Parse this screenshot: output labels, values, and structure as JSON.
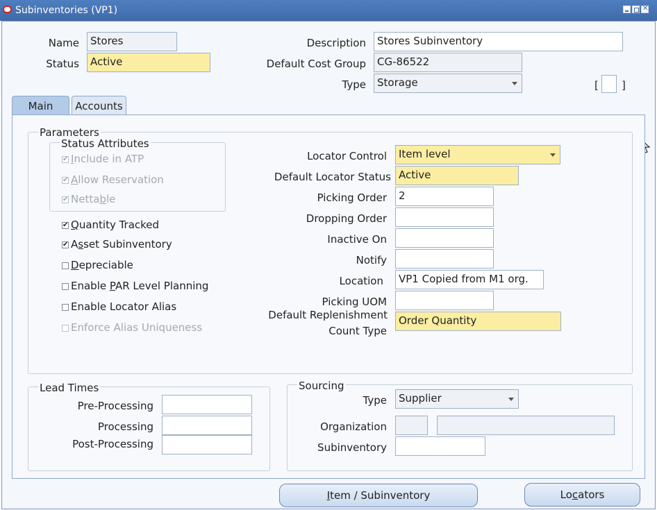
{
  "window": {
    "title": "Subinventories (VP1)"
  },
  "header": {
    "name_label": "Name",
    "name_value": "Stores",
    "status_label": "Status",
    "status_value": "Active",
    "description_label": "Description",
    "description_value": "Stores Subinventory",
    "cost_group_label": "Default Cost Group",
    "cost_group_value": "CG-86522",
    "type_label": "Type",
    "type_value": "Storage",
    "bracket_left": "[",
    "bracket_right": "]"
  },
  "tabs": [
    {
      "label": "Main",
      "active": true
    },
    {
      "label": "Accounts",
      "active": false
    }
  ],
  "parameters": {
    "title": "Parameters",
    "status_attributes": {
      "title": "Status Attributes",
      "items": [
        {
          "pre": "",
          "u": "I",
          "post": "nclude in ATP",
          "checked": true
        },
        {
          "pre": "",
          "u": "A",
          "post": "llow Reservation",
          "checked": true
        },
        {
          "pre": "Netta",
          "u": "b",
          "post": "le",
          "checked": true
        }
      ]
    },
    "checkboxes": [
      {
        "pre": "",
        "u": "Q",
        "post": "uantity Tracked",
        "checked": true,
        "enabled": true
      },
      {
        "pre": "A",
        "u": "s",
        "post": "set Subinventory",
        "checked": true,
        "enabled": true
      },
      {
        "pre": "",
        "u": "D",
        "post": "epreciable",
        "checked": false,
        "enabled": true
      },
      {
        "pre": "Enable ",
        "u": "P",
        "post": "AR Level Planning",
        "checked": false,
        "enabled": true
      },
      {
        "pre": "Enable Locator Alias",
        "u": "",
        "post": "",
        "checked": false,
        "enabled": true
      },
      {
        "pre": "Enforce Alias Uniqueness",
        "u": "",
        "post": "",
        "checked": false,
        "enabled": false
      }
    ],
    "locator_control_label": "Locator Control",
    "locator_control_value": "Item level",
    "default_locator_status_label": "Default Locator Status",
    "default_locator_status_value": "Active",
    "picking_order_label": "Picking Order",
    "picking_order_value": "2",
    "dropping_order_label": "Dropping Order",
    "dropping_order_value": "",
    "inactive_on_label": "Inactive On",
    "inactive_on_value": "",
    "notify_label": "Notify",
    "notify_value": "",
    "location_label": "Location",
    "location_value": "VP1 Copied from M1 org.",
    "picking_uom_label": "Picking UOM",
    "picking_uom_value": "",
    "replenishment_label_line1": "Default Replenishment",
    "replenishment_label_line2": "Count Type",
    "replenishment_value": "Order Quantity"
  },
  "lead_times": {
    "title": "Lead Times",
    "pre_label": "Pre-Processing",
    "pre_value": "",
    "proc_label": "Processing",
    "proc_value": "",
    "post_label": "Post-Processing",
    "post_value": ""
  },
  "sourcing": {
    "title": "Sourcing",
    "type_label": "Type",
    "type_value": "Supplier",
    "org_label": "Organization",
    "org_code": "",
    "org_name": "",
    "subinv_label": "Subinventory",
    "subinv_value": ""
  },
  "buttons": {
    "item_sub": {
      "pre": "",
      "u": "I",
      "post": "tem / Subinventory"
    },
    "locators": {
      "pre": "Lo",
      "u": "c",
      "post": "ators"
    }
  },
  "colors": {
    "titlebar": "#3f6aa8",
    "required_field": "#fbeea2",
    "button": "#c9daef"
  }
}
